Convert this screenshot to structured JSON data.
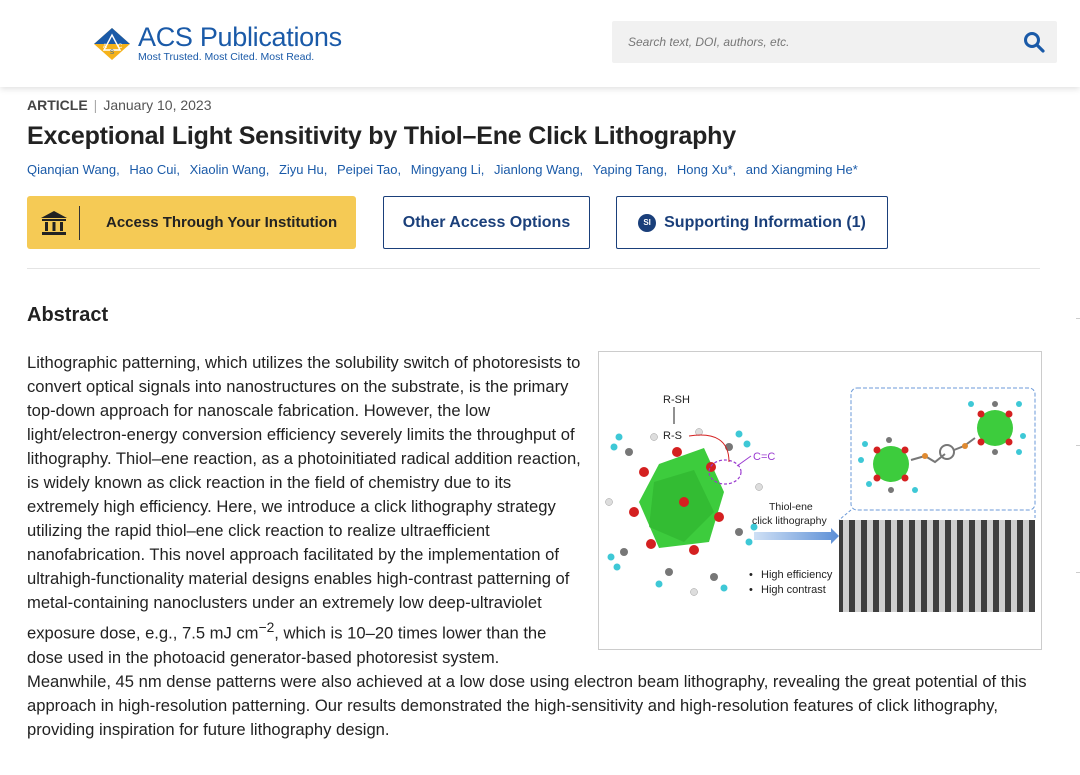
{
  "header": {
    "logo_name": "ACS Publications",
    "logo_tagline": "Most Trusted. Most Cited. Most Read.",
    "search_placeholder": "Search text, DOI, authors, etc."
  },
  "article": {
    "type": "ARTICLE",
    "separator": "|",
    "date": "January 10, 2023",
    "title": "Exceptional Light Sensitivity by Thiol–Ene Click Lithography",
    "authors": [
      "Qianqian Wang,",
      "Hao Cui,",
      "Xiaolin Wang,",
      "Ziyu Hu,",
      "Peipei Tao,",
      "Mingyang Li,",
      "Jianlong Wang,",
      "Yaping Tang,",
      "Hong Xu*,",
      "and Xiangming He*"
    ]
  },
  "access": {
    "institution_label": "Access Through Your Institution",
    "other_label": "Other Access Options",
    "si_badge": "SI",
    "si_label": "Supporting Information (1)"
  },
  "abstract": {
    "heading": "Abstract",
    "text_before_sup": "Lithographic patterning, which utilizes the solubility switch of photoresists to convert optical signals into nanostructures on the substrate, is the primary top-down approach for nanoscale fabrication. However, the low light/electron-energy conversion efficiency severely limits the throughput of lithography. Thiol–ene reaction, as a photoinitiated radical addition reaction, is widely known as click reaction in the field of chemistry due to its extremely high efficiency. Here, we introduce a click lithography strategy utilizing the rapid thiol–ene click reaction to realize ultraefficient nanofabrication. This novel approach facilitated by the implementation of ultrahigh-functionality material designs enables high-contrast patterning of metal-containing nanoclusters under an extremely low deep-ultraviolet exposure dose, e.g., 7.5 mJ cm",
    "sup": "−2",
    "text_after_sup": ", which is 10–20 times lower than the dose used in the photoacid generator-based photoresist system. Meanwhile, 45 nm dense patterns were also achieved at a low dose using electron beam lithography, revealing the great potential of this approach in high-resolution patterning. Our results demonstrated the high-sensitivity and high-resolution features of click lithography, providing inspiration for future lithography design."
  },
  "toc_graphic": {
    "rsh": "R-SH",
    "rs": "R-S",
    "cc": "C=C",
    "arrow_label_1": "Thiol-ene",
    "arrow_label_2": "click lithography",
    "bullet_1": "High efficiency",
    "bullet_2": "High contrast",
    "colors": {
      "cluster": "#3dcc3d",
      "oxygen": "#d42020",
      "carbon": "#777777",
      "hydrogen": "#3ec8d6",
      "sulfur": "#e08a30",
      "linker": "#9a3ad0"
    }
  },
  "colors": {
    "brand_blue": "#1a5aa8",
    "button_navy": "#1a3f7a",
    "institution_yellow": "#f5ca55"
  }
}
